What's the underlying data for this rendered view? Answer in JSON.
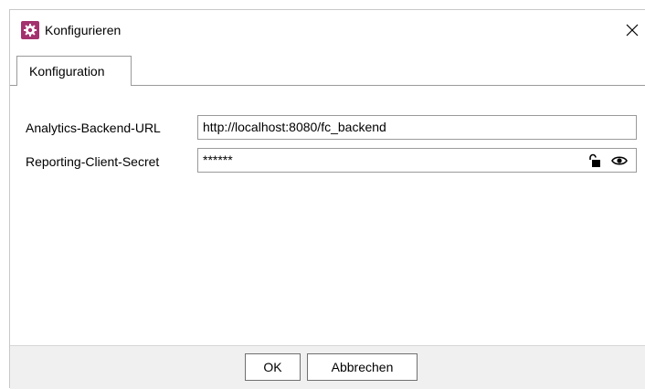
{
  "window": {
    "title": "Konfigurieren"
  },
  "tabs": [
    {
      "label": "Konfiguration",
      "active": true
    }
  ],
  "form": {
    "fields": [
      {
        "label": "Analytics-Backend-URL",
        "value": "http://localhost:8080/fc_backend"
      },
      {
        "label": "Reporting-Client-Secret",
        "value": "******"
      }
    ]
  },
  "buttons": {
    "ok_label": "OK",
    "cancel_label": "Abbrechen"
  },
  "colors": {
    "app_icon": "#a3316e",
    "footer_bg": "#f0f0f0",
    "border": "#9a9a9a"
  },
  "icons": {
    "app": "gear-icon",
    "close": "close-icon",
    "lock": "unlock-icon",
    "reveal": "eye-icon"
  }
}
